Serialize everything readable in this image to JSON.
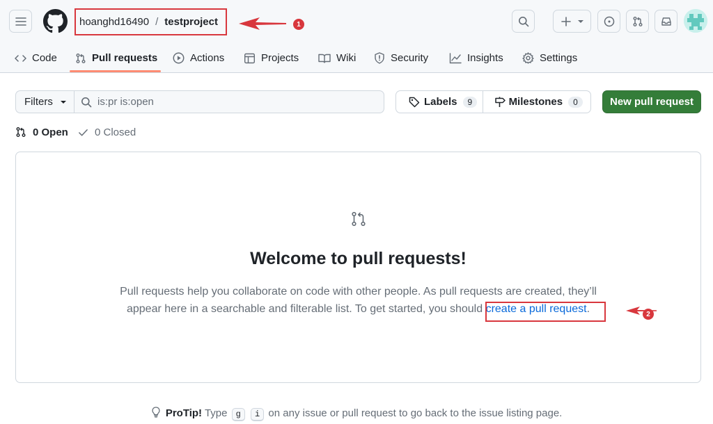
{
  "header": {
    "owner": "hoanghd16490",
    "separator": "/",
    "repo": "testproject",
    "annotation_1": "1"
  },
  "tabs": [
    {
      "label": "Code",
      "icon": "code-icon"
    },
    {
      "label": "Pull requests",
      "icon": "git-pull-request-icon",
      "active": true
    },
    {
      "label": "Actions",
      "icon": "play-icon"
    },
    {
      "label": "Projects",
      "icon": "table-icon"
    },
    {
      "label": "Wiki",
      "icon": "book-icon"
    },
    {
      "label": "Security",
      "icon": "shield-icon"
    },
    {
      "label": "Insights",
      "icon": "graph-icon"
    },
    {
      "label": "Settings",
      "icon": "gear-icon"
    }
  ],
  "toolbar": {
    "filters_label": "Filters",
    "search_value": "is:pr is:open",
    "labels_label": "Labels",
    "labels_count": "9",
    "milestones_label": "Milestones",
    "milestones_count": "0",
    "new_pr_label": "New pull request"
  },
  "states": {
    "open_label": "0 Open",
    "closed_label": "0 Closed"
  },
  "blankslate": {
    "title": "Welcome to pull requests!",
    "desc_line1": "Pull requests help you collaborate on code with other people. As pull requests are created, they’ll",
    "desc_line2": "appear here in a searchable and filterable list. To get started, you should",
    "link_text": "create a pull request",
    "period": ".",
    "annotation_2": "2"
  },
  "protip": {
    "label": "ProTip!",
    "text_before": "Type",
    "key1": "g",
    "key2": "i",
    "text_after": "on any issue or pull request to go back to the issue listing page."
  },
  "colors": {
    "annotation_red": "#d8373d",
    "primary_green": "#347d39",
    "link_blue": "#0969da",
    "tab_underline": "#fd8c73"
  }
}
